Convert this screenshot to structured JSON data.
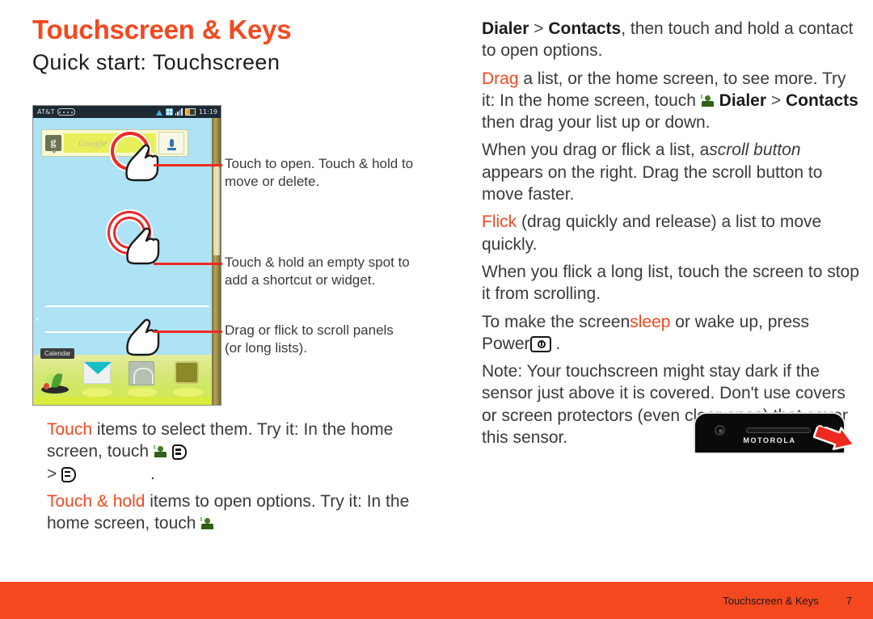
{
  "header": {
    "title": "Touchscreen & Keys",
    "subtitle": "Quick start: Touchscreen",
    "title_color": "#f4481e"
  },
  "phone_screenshot": {
    "statusbar": {
      "carrier": "AT&T",
      "time": "11:19",
      "icons": [
        "wifi-icon",
        "sync-icon",
        "signal-icon",
        "battery-icon"
      ]
    },
    "search_widget": {
      "logo": "g",
      "placeholder": "Google",
      "mic": "microphone-icon"
    },
    "calendar_label": "Calendar",
    "dock_icons": [
      "plant-icon",
      "messaging-icon",
      "clock-icon",
      "app-icon"
    ]
  },
  "callouts": [
    {
      "id": "callout-open",
      "text": "Touch to open. Touch & hold to move or delete."
    },
    {
      "id": "callout-shortcut",
      "text": "Touch & hold an empty spot to add a shortcut or widget."
    },
    {
      "id": "callout-scroll",
      "text": "Drag or flick to scroll panels (or long lists)."
    }
  ],
  "left_body": {
    "p1_kw": "Touch",
    "p1_rest": " items to select them. Try it: In the home screen, touch",
    "p1_icon1": "contact-icon",
    "p1_icon2": "book-icon",
    "p1_line3_gt": ">",
    "p1_icon3": "book-icon",
    "p1_line3_end": ".",
    "p2_kw": "Touch & hold",
    "p2_rest": " items to open options. Try it: In the home screen, touch",
    "p2_icon": "contact-icon"
  },
  "right_body": {
    "p1_a": "Dialer",
    "p1_gt": ">",
    "p1_b": "Contacts",
    "p1_rest": ", then touch and hold a contact to open options.",
    "p2_kw": "Drag",
    "p2_rest": " a list, or the home screen, to see more. Try it: In the home screen, touch",
    "p2_icon": "contact-icon",
    "p2_a": "Dialer",
    "p2_gt": ">",
    "p2_b": "Contacts",
    "p2_end": "then drag your list up or down.",
    "p3_pre": "When you drag or flick a list, a",
    "p3_ital": "scroll button",
    "p3_post": " appears on the right. Drag the scroll button to move faster.",
    "p4_kw": "Flick",
    "p4_rest": " (drag quickly and release) a list to move quickly.",
    "p5": "When you flick a long list, touch the screen to stop it from scrolling.",
    "p6_pre": "To make the screen",
    "p6_kw": "sleep",
    "p6_mid": " or wake up, press Power",
    "p6_icon": "power-button-icon",
    "p6_end": ".",
    "p7_label": "Note:",
    "p7_text": " Your touchscreen might stay dark if the sensor just above it is covered. Don't use covers or screen protectors (even clear ones) that cover this sensor."
  },
  "phone_bezel": {
    "brand": "MOTOROLA",
    "parts": [
      "front-camera",
      "earpiece-speaker",
      "proximity-sensor"
    ],
    "arrow_color": "#ee2a20"
  },
  "footer": {
    "chapter": "Touchscreen & Keys",
    "page_number": "7",
    "background": "#f4481e"
  }
}
